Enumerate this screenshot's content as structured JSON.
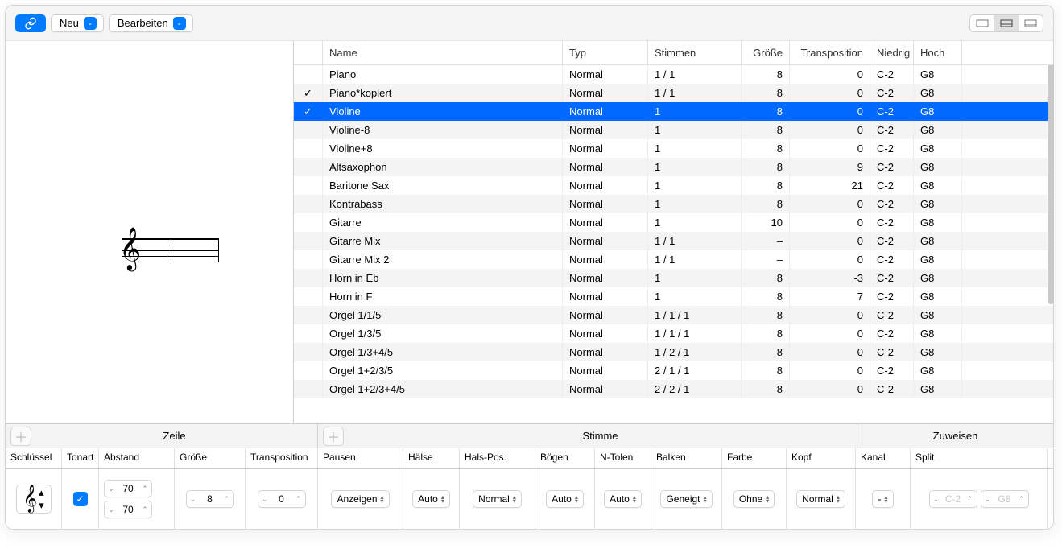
{
  "toolbar": {
    "neu": "Neu",
    "bearbeiten": "Bearbeiten"
  },
  "columns": {
    "name": "Name",
    "typ": "Typ",
    "stimmen": "Stimmen",
    "groesse": "Größe",
    "transposition": "Transposition",
    "niedrig": "Niedrig",
    "hoch": "Hoch"
  },
  "rows": [
    {
      "check": "",
      "name": "Piano",
      "typ": "Normal",
      "stimmen": "1 / 1",
      "groesse": "8",
      "trans": "0",
      "niedrig": "C-2",
      "hoch": "G8",
      "sel": false
    },
    {
      "check": "✓",
      "checklight": true,
      "name": "Piano*kopiert",
      "typ": "Normal",
      "stimmen": "1 / 1",
      "groesse": "8",
      "trans": "0",
      "niedrig": "C-2",
      "hoch": "G8",
      "sel": false
    },
    {
      "check": "✓",
      "name": "Violine",
      "typ": "Normal",
      "stimmen": "1",
      "groesse": "8",
      "trans": "0",
      "niedrig": "C-2",
      "hoch": "G8",
      "sel": true
    },
    {
      "check": "",
      "name": "Violine-8",
      "typ": "Normal",
      "stimmen": "1",
      "groesse": "8",
      "trans": "0",
      "niedrig": "C-2",
      "hoch": "G8",
      "sel": false
    },
    {
      "check": "",
      "name": "Violine+8",
      "typ": "Normal",
      "stimmen": "1",
      "groesse": "8",
      "trans": "0",
      "niedrig": "C-2",
      "hoch": "G8",
      "sel": false
    },
    {
      "check": "",
      "name": "Altsaxophon",
      "typ": "Normal",
      "stimmen": "1",
      "groesse": "8",
      "trans": "9",
      "niedrig": "C-2",
      "hoch": "G8",
      "sel": false
    },
    {
      "check": "",
      "name": "Baritone Sax",
      "typ": "Normal",
      "stimmen": "1",
      "groesse": "8",
      "trans": "21",
      "niedrig": "C-2",
      "hoch": "G8",
      "sel": false
    },
    {
      "check": "",
      "name": "Kontrabass",
      "typ": "Normal",
      "stimmen": "1",
      "groesse": "8",
      "trans": "0",
      "niedrig": "C-2",
      "hoch": "G8",
      "sel": false
    },
    {
      "check": "",
      "name": "Gitarre",
      "typ": "Normal",
      "stimmen": "1",
      "groesse": "10",
      "trans": "0",
      "niedrig": "C-2",
      "hoch": "G8",
      "sel": false
    },
    {
      "check": "",
      "name": "Gitarre Mix",
      "typ": "Normal",
      "stimmen": "1 / 1",
      "groesse": "–",
      "trans": "0",
      "niedrig": "C-2",
      "hoch": "G8",
      "sel": false
    },
    {
      "check": "",
      "name": "Gitarre Mix 2",
      "typ": "Normal",
      "stimmen": "1 / 1",
      "groesse": "–",
      "trans": "0",
      "niedrig": "C-2",
      "hoch": "G8",
      "sel": false
    },
    {
      "check": "",
      "name": "Horn in Eb",
      "typ": "Normal",
      "stimmen": "1",
      "groesse": "8",
      "trans": "-3",
      "niedrig": "C-2",
      "hoch": "G8",
      "sel": false
    },
    {
      "check": "",
      "name": "Horn in F",
      "typ": "Normal",
      "stimmen": "1",
      "groesse": "8",
      "trans": "7",
      "niedrig": "C-2",
      "hoch": "G8",
      "sel": false
    },
    {
      "check": "",
      "name": "Orgel 1/1/5",
      "typ": "Normal",
      "stimmen": "1 / 1 / 1",
      "groesse": "8",
      "trans": "0",
      "niedrig": "C-2",
      "hoch": "G8",
      "sel": false
    },
    {
      "check": "",
      "name": "Orgel 1/3/5",
      "typ": "Normal",
      "stimmen": "1 / 1 / 1",
      "groesse": "8",
      "trans": "0",
      "niedrig": "C-2",
      "hoch": "G8",
      "sel": false
    },
    {
      "check": "",
      "name": "Orgel 1/3+4/5",
      "typ": "Normal",
      "stimmen": "1 / 2 / 1",
      "groesse": "8",
      "trans": "0",
      "niedrig": "C-2",
      "hoch": "G8",
      "sel": false
    },
    {
      "check": "",
      "name": "Orgel 1+2/3/5",
      "typ": "Normal",
      "stimmen": "2 / 1 / 1",
      "groesse": "8",
      "trans": "0",
      "niedrig": "C-2",
      "hoch": "G8",
      "sel": false
    },
    {
      "check": "",
      "name": "Orgel 1+2/3+4/5",
      "typ": "Normal",
      "stimmen": "2 / 2 / 1",
      "groesse": "8",
      "trans": "0",
      "niedrig": "C-2",
      "hoch": "G8",
      "sel": false
    }
  ],
  "sections": {
    "zeile": "Zeile",
    "stimme": "Stimme",
    "zuweisen": "Zuweisen"
  },
  "bottom_cols": {
    "schluessel": "Schlüssel",
    "tonart": "Tonart",
    "abstand": "Abstand",
    "groesse": "Größe",
    "transposition": "Transposition",
    "pausen": "Pausen",
    "haelse": "Hälse",
    "halspos": "Hals-Pos.",
    "boegen": "Bögen",
    "ntolen": "N-Tolen",
    "balken": "Balken",
    "farbe": "Farbe",
    "kopf": "Kopf",
    "kanal": "Kanal",
    "split": "Split"
  },
  "bottom_vals": {
    "abstand1": "70",
    "abstand2": "70",
    "groesse": "8",
    "transposition": "0",
    "pausen": "Anzeigen",
    "haelse": "Auto",
    "halspos": "Normal",
    "boegen": "Auto",
    "ntolen": "Auto",
    "balken": "Geneigt",
    "farbe": "Ohne",
    "kopf": "Normal",
    "kanal": "-",
    "split_low": "C-2",
    "split_high": "G8"
  }
}
